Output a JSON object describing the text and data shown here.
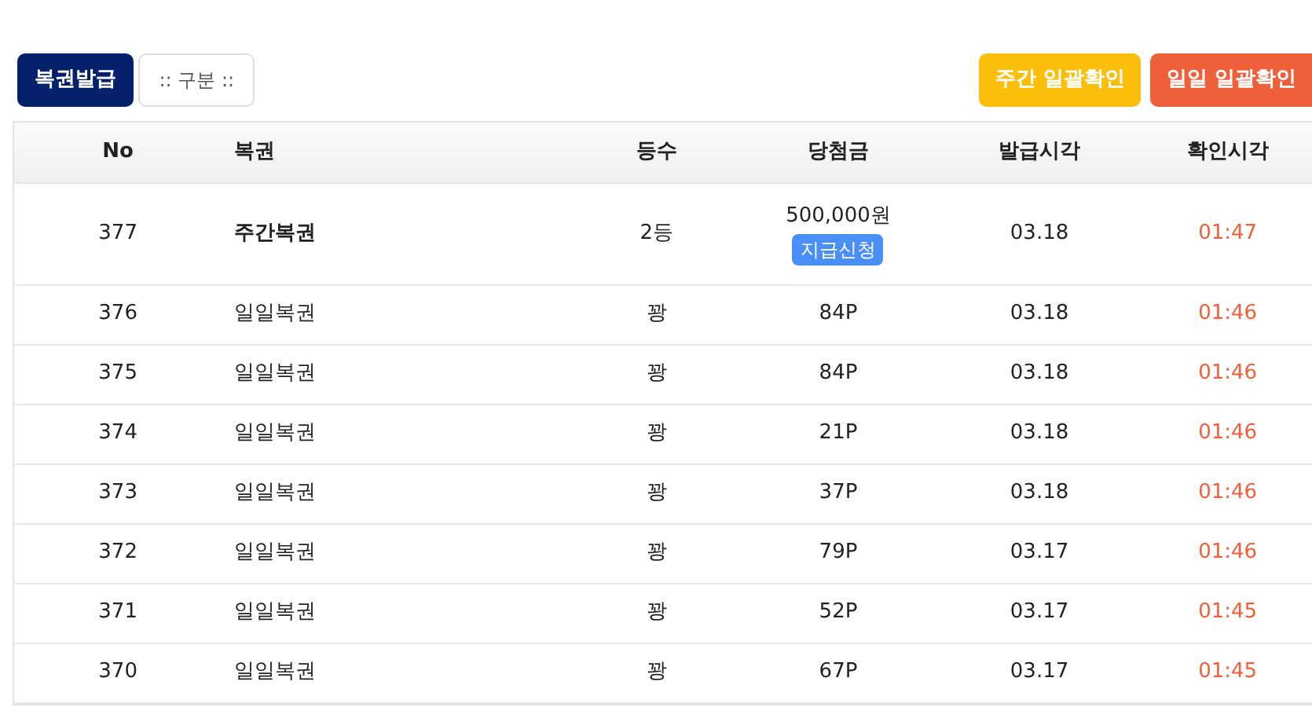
{
  "toolbar": {
    "issue_button": "복권발급",
    "category_select": ":: 구분 ::",
    "weekly_check_button": "주간 일괄확인",
    "daily_check_button": "일일 일괄확인"
  },
  "table": {
    "columns": [
      "No",
      "복권",
      "등수",
      "당첨금",
      "발급시각",
      "확인시각"
    ],
    "rows": [
      {
        "kind": "weekly",
        "no": "377",
        "ticket": "주간복권",
        "rank": "2등",
        "prize": "500,000원",
        "claim_button": "지급신청",
        "issued": "03.18",
        "checked": "01:47"
      },
      {
        "kind": "daily",
        "no": "376",
        "ticket": "일일복권",
        "rank": "꽝",
        "prize": "84P",
        "issued": "03.18",
        "checked": "01:46"
      },
      {
        "kind": "daily",
        "no": "375",
        "ticket": "일일복권",
        "rank": "꽝",
        "prize": "84P",
        "issued": "03.18",
        "checked": "01:46"
      },
      {
        "kind": "daily",
        "no": "374",
        "ticket": "일일복권",
        "rank": "꽝",
        "prize": "21P",
        "issued": "03.18",
        "checked": "01:46"
      },
      {
        "kind": "daily",
        "no": "373",
        "ticket": "일일복권",
        "rank": "꽝",
        "prize": "37P",
        "issued": "03.18",
        "checked": "01:46"
      },
      {
        "kind": "daily",
        "no": "372",
        "ticket": "일일복권",
        "rank": "꽝",
        "prize": "79P",
        "issued": "03.17",
        "checked": "01:46"
      },
      {
        "kind": "daily",
        "no": "371",
        "ticket": "일일복권",
        "rank": "꽝",
        "prize": "52P",
        "issued": "03.17",
        "checked": "01:45"
      },
      {
        "kind": "daily",
        "no": "370",
        "ticket": "일일복권",
        "rank": "꽝",
        "prize": "67P",
        "issued": "03.17",
        "checked": "01:45"
      }
    ]
  }
}
